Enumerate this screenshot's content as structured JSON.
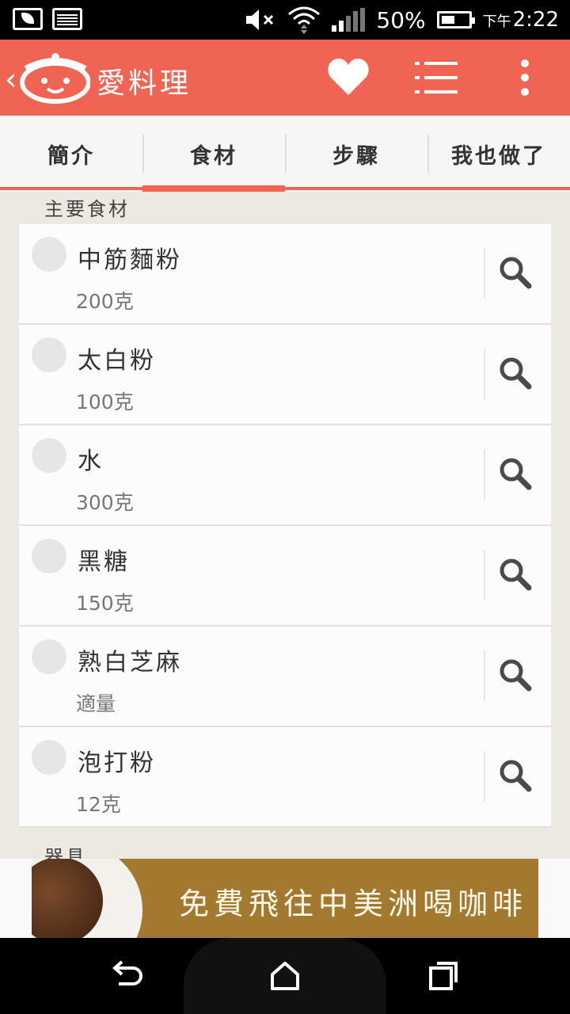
{
  "status_bar": {
    "battery_percent": "50%",
    "time_prefix": "下午",
    "time": "2:22",
    "icons": [
      "leaf-notification-icon",
      "image-notification-icon",
      "mute-icon",
      "wifi-icon",
      "signal-icon",
      "battery-charging-icon"
    ]
  },
  "app_bar": {
    "title": "愛料理",
    "icons": [
      "back-icon",
      "app-logo",
      "favorite-heart-icon",
      "list-menu-icon",
      "overflow-menu-icon"
    ],
    "accent_color": "#f06454"
  },
  "tabs": [
    {
      "label": "簡介",
      "active": false
    },
    {
      "label": "食材",
      "active": true
    },
    {
      "label": "步驟",
      "active": false
    },
    {
      "label": "我也做了",
      "active": false
    }
  ],
  "main_section_label": "主要食材",
  "ingredients": [
    {
      "name": "中筋麵粉",
      "qty": "200克"
    },
    {
      "name": "太白粉",
      "qty": "100克"
    },
    {
      "name": "水",
      "qty": "300克"
    },
    {
      "name": "黑糖",
      "qty": "150克"
    },
    {
      "name": "熟白芝麻",
      "qty": "適量"
    },
    {
      "name": "泡打粉",
      "qty": "12克"
    }
  ],
  "tools_section_label": "器具",
  "ad": {
    "text": "免費飛往中美洲喝咖啡"
  },
  "nav_bar": {
    "icons": [
      "back-nav-icon",
      "home-nav-icon",
      "recents-nav-icon"
    ]
  }
}
